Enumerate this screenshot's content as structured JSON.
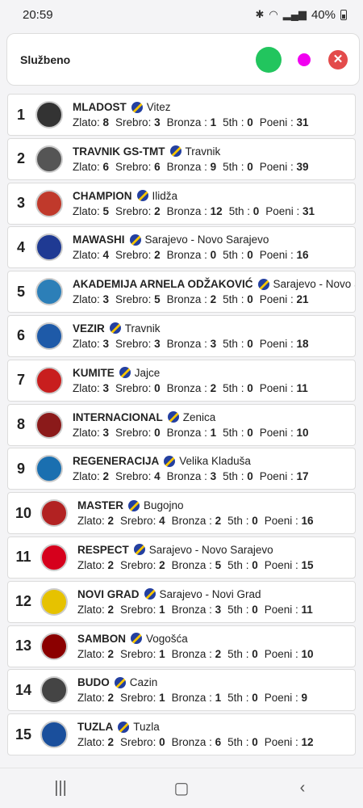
{
  "status": {
    "time": "20:59",
    "battery": "40%"
  },
  "header": {
    "title": "Službeno"
  },
  "labels": {
    "gold": "Zlato:",
    "silver": "Srebro:",
    "bronze": "Bronza :",
    "fifth": "5th :",
    "points": "Poeni :"
  },
  "clubs": [
    {
      "rank": "1",
      "name": "MLADOST",
      "city": "Vitez",
      "gold": "8",
      "silver": "3",
      "bronze": "1",
      "fifth": "0",
      "points": "31"
    },
    {
      "rank": "2",
      "name": "TRAVNIK GS-TMT",
      "city": "Travnik",
      "gold": "6",
      "silver": "6",
      "bronze": "9",
      "fifth": "0",
      "points": "39"
    },
    {
      "rank": "3",
      "name": "CHAMPION",
      "city": "Ilidža",
      "gold": "5",
      "silver": "2",
      "bronze": "12",
      "fifth": "0",
      "points": "31"
    },
    {
      "rank": "4",
      "name": "MAWASHI",
      "city": "Sarajevo - Novo Sarajevo",
      "gold": "4",
      "silver": "2",
      "bronze": "0",
      "fifth": "0",
      "points": "16"
    },
    {
      "rank": "5",
      "name": "AKADEMIJA ARNELA ODŽAKOVIĆ",
      "city": "Sarajevo - Novo Sarajevo",
      "gold": "3",
      "silver": "5",
      "bronze": "2",
      "fifth": "0",
      "points": "21"
    },
    {
      "rank": "6",
      "name": "VEZIR",
      "city": "Travnik",
      "gold": "3",
      "silver": "3",
      "bronze": "3",
      "fifth": "0",
      "points": "18"
    },
    {
      "rank": "7",
      "name": "KUMITE",
      "city": "Jajce",
      "gold": "3",
      "silver": "0",
      "bronze": "2",
      "fifth": "0",
      "points": "11"
    },
    {
      "rank": "8",
      "name": "INTERNACIONAL",
      "city": "Zenica",
      "gold": "3",
      "silver": "0",
      "bronze": "1",
      "fifth": "0",
      "points": "10"
    },
    {
      "rank": "9",
      "name": "REGENERACIJA",
      "city": "Velika Kladuša",
      "gold": "2",
      "silver": "4",
      "bronze": "3",
      "fifth": "0",
      "points": "17"
    },
    {
      "rank": "10",
      "name": "MASTER",
      "city": "Bugojno",
      "gold": "2",
      "silver": "4",
      "bronze": "2",
      "fifth": "0",
      "points": "16"
    },
    {
      "rank": "11",
      "name": "RESPECT",
      "city": "Sarajevo - Novo Sarajevo",
      "gold": "2",
      "silver": "2",
      "bronze": "5",
      "fifth": "0",
      "points": "15"
    },
    {
      "rank": "12",
      "name": "NOVI GRAD",
      "city": "Sarajevo - Novi Grad",
      "gold": "2",
      "silver": "1",
      "bronze": "3",
      "fifth": "0",
      "points": "11"
    },
    {
      "rank": "13",
      "name": "SAMBON",
      "city": "Vogošća",
      "gold": "2",
      "silver": "1",
      "bronze": "2",
      "fifth": "0",
      "points": "10"
    },
    {
      "rank": "14",
      "name": "BUDO",
      "city": "Cazin",
      "gold": "2",
      "silver": "1",
      "bronze": "1",
      "fifth": "0",
      "points": "9"
    },
    {
      "rank": "15",
      "name": "TUZLA",
      "city": "Tuzla",
      "gold": "2",
      "silver": "0",
      "bronze": "6",
      "fifth": "0",
      "points": "12"
    }
  ],
  "colors": {
    "green": "#22c55e",
    "pink": "#f100f0",
    "close": "#e34b4b"
  }
}
